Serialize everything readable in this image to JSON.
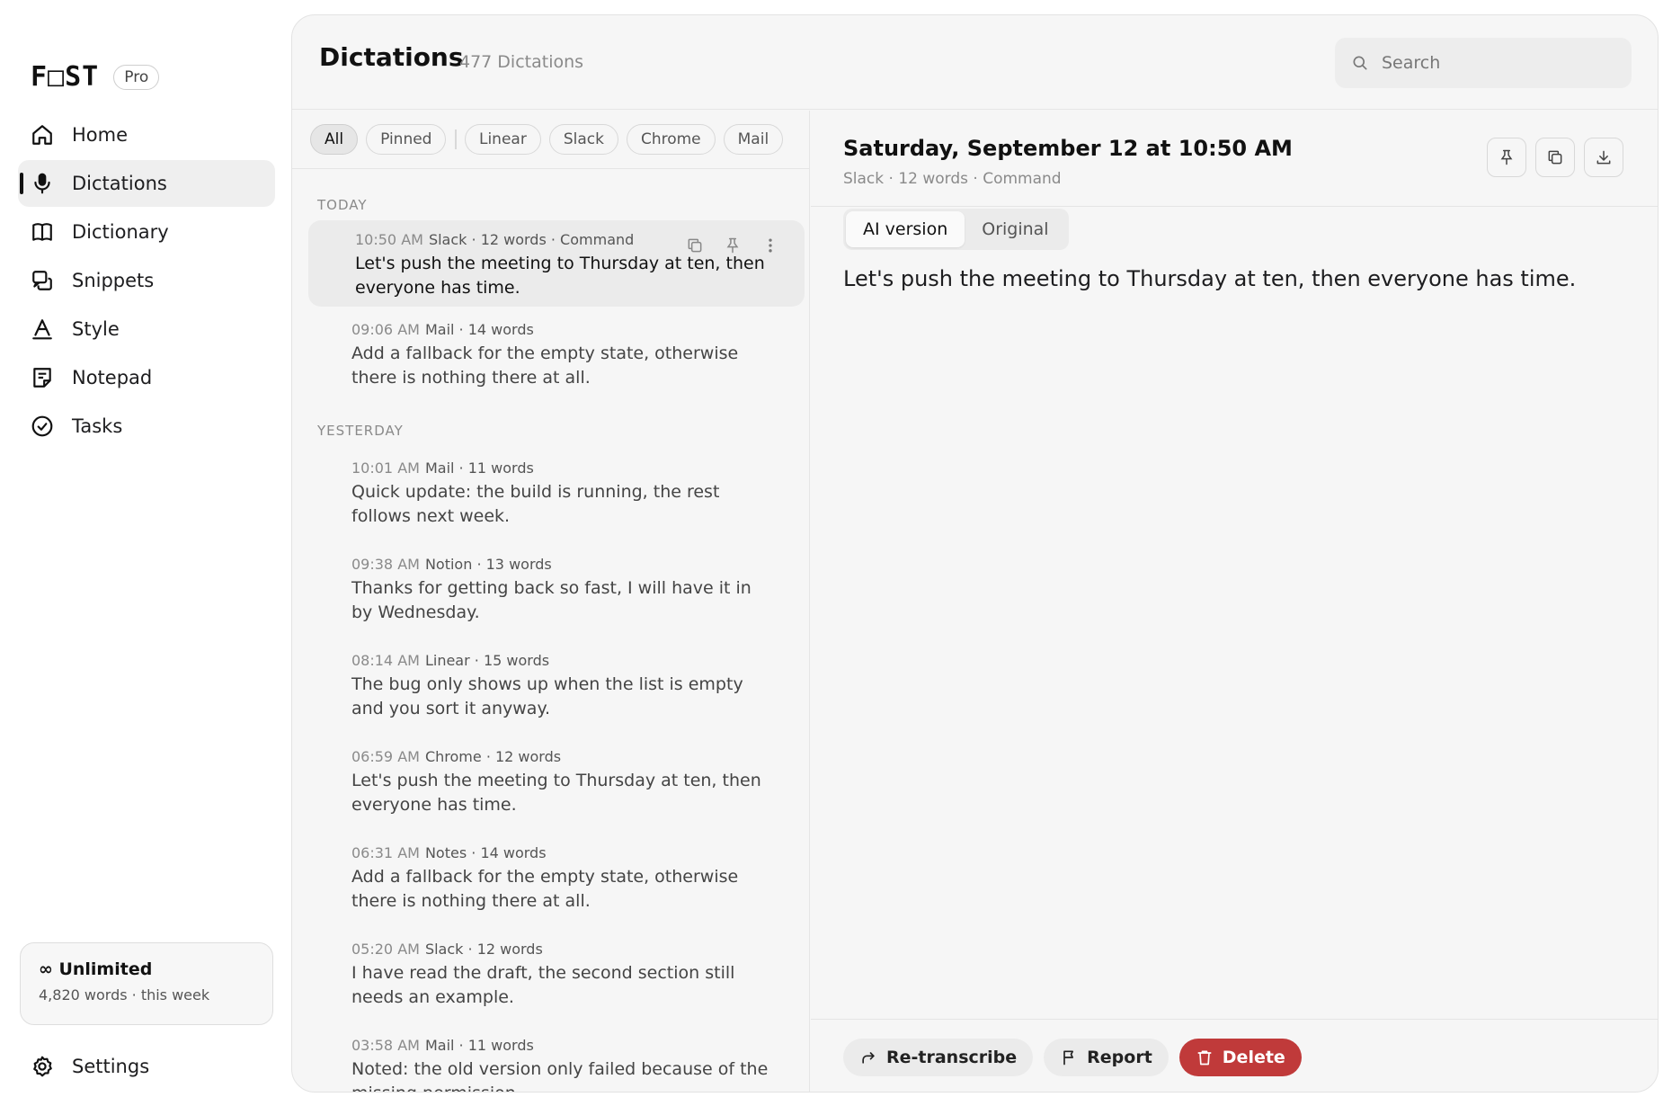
{
  "brand": {
    "logo": "F□ST",
    "badge": "Pro"
  },
  "nav": {
    "items": [
      {
        "label": "Home"
      },
      {
        "label": "Dictations"
      },
      {
        "label": "Dictionary"
      },
      {
        "label": "Snippets"
      },
      {
        "label": "Style"
      },
      {
        "label": "Notepad"
      },
      {
        "label": "Tasks"
      }
    ],
    "active": "Dictations",
    "settings": "Settings"
  },
  "plan": {
    "title": "∞ Unlimited",
    "usage": "4,820 words · this week"
  },
  "header": {
    "title": "Dictations",
    "count": "477 Dictations",
    "search_placeholder": "Search"
  },
  "filters": {
    "chips": [
      {
        "label": "All"
      },
      {
        "label": "Pinned"
      },
      {
        "label": "Linear"
      },
      {
        "label": "Slack"
      },
      {
        "label": "Chrome"
      },
      {
        "label": "Mail"
      }
    ],
    "active": "All"
  },
  "list": {
    "today_label": "TODAY",
    "yesterday_label": "YESTERDAY",
    "today": [
      {
        "time": "10:50 AM",
        "app": "Slack",
        "details": "· 12 words · Command",
        "text": "Let's push the meeting to Thursday at ten, then everyone has time."
      },
      {
        "time": "09:06 AM",
        "app": "Mail",
        "details": "· 14 words",
        "text": "Add a fallback for the empty state, otherwise there is nothing there at all."
      }
    ],
    "yesterday": [
      {
        "time": "10:01 AM",
        "app": "Mail",
        "details": "· 11 words",
        "text": "Quick update: the build is running, the rest follows next week."
      },
      {
        "time": "09:38 AM",
        "app": "Notion",
        "details": "· 13 words",
        "text": "Thanks for getting back so fast, I will have it in by Wednesday."
      },
      {
        "time": "08:14 AM",
        "app": "Linear",
        "details": "· 15 words",
        "text": "The bug only shows up when the list is empty and you sort it anyway."
      },
      {
        "time": "06:59 AM",
        "app": "Chrome",
        "details": "· 12 words",
        "text": "Let's push the meeting to Thursday at ten, then everyone has time."
      },
      {
        "time": "06:31 AM",
        "app": "Notes",
        "details": "· 14 words",
        "text": "Add a fallback for the empty state, otherwise there is nothing there at all."
      },
      {
        "time": "05:20 AM",
        "app": "Slack",
        "details": "· 12 words",
        "text": "I have read the draft, the second section still needs an example."
      },
      {
        "time": "03:58 AM",
        "app": "Mail",
        "details": "· 11 words",
        "text": "Noted: the old version only failed because of the missing permission."
      }
    ]
  },
  "detail": {
    "title": "Saturday, September 12 at 10:50 AM",
    "meta": "Slack · 12 words · Command",
    "tabs": {
      "ai": "AI version",
      "original": "Original"
    },
    "active_tab": "AI version",
    "body": "Let's push the meeting to Thursday at ten, then everyone has time.",
    "actions": {
      "retranscribe": "Re-transcribe",
      "report": "Report",
      "delete": "Delete"
    }
  },
  "colors": {
    "accent": "#111111",
    "danger": "#c03a3a",
    "panel": "#f6f6f6"
  }
}
